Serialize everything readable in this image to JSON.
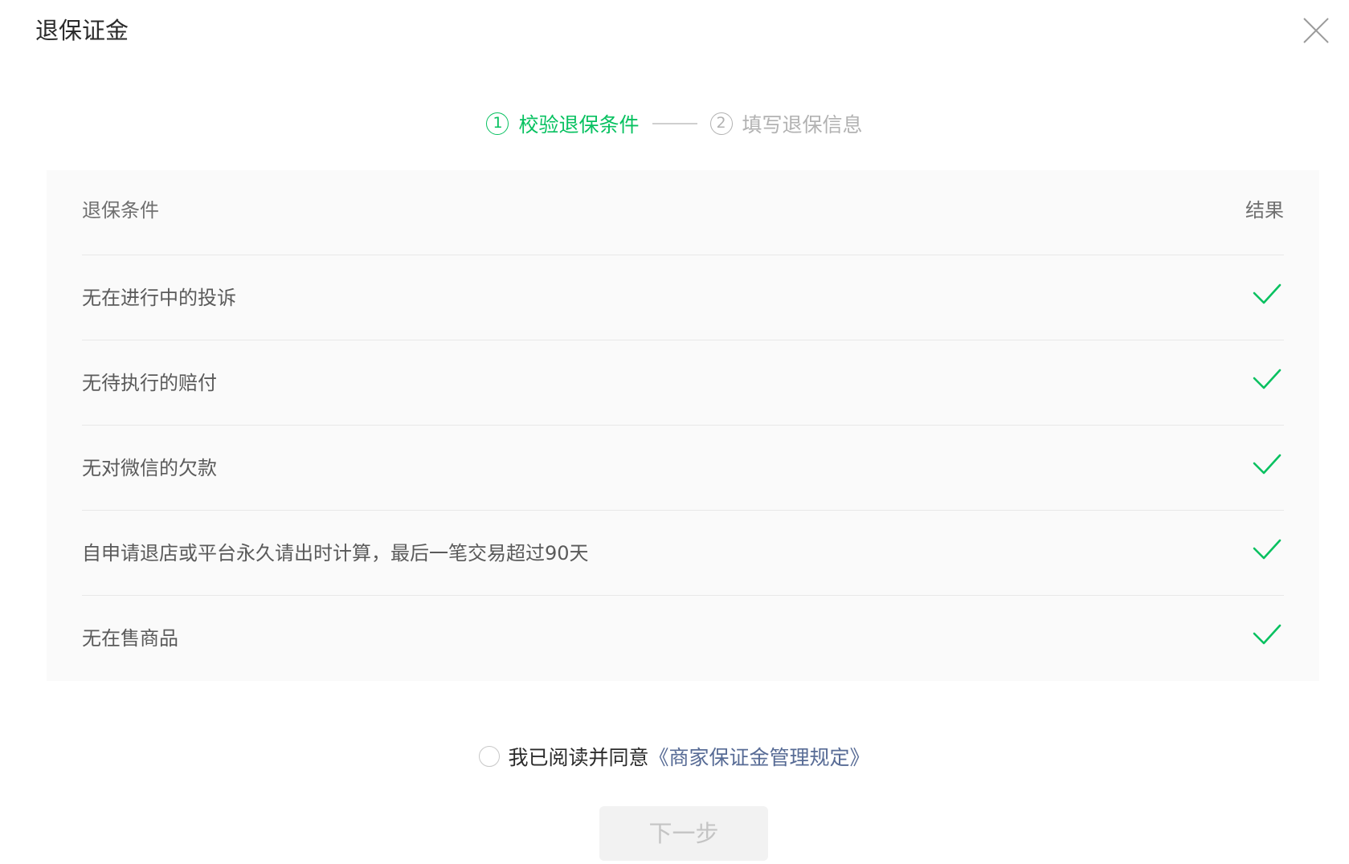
{
  "dialog": {
    "title": "退保证金"
  },
  "steps": [
    {
      "num": "1",
      "label": "校验退保条件",
      "state": "active"
    },
    {
      "num": "2",
      "label": "填写退保信息",
      "state": "inactive"
    }
  ],
  "table": {
    "col_condition": "退保条件",
    "col_result": "结果",
    "rows": [
      {
        "label": "无在进行中的投诉",
        "result": "check-icon"
      },
      {
        "label": "无待执行的赔付",
        "result": "check-icon"
      },
      {
        "label": "无对微信的欠款",
        "result": "check-icon"
      },
      {
        "label": "自申请退店或平台永久请出时计算，最后一笔交易超过90天",
        "result": "check-icon"
      },
      {
        "label": "无在售商品",
        "result": "check-icon"
      }
    ]
  },
  "agreement": {
    "text": "我已阅读并同意",
    "link": "《商家保证金管理规定》",
    "checked": false
  },
  "buttons": {
    "next": "下一步"
  },
  "colors": {
    "accent_green": "#07c160",
    "link_blue": "#576b95",
    "muted": "#b2b2b2"
  }
}
